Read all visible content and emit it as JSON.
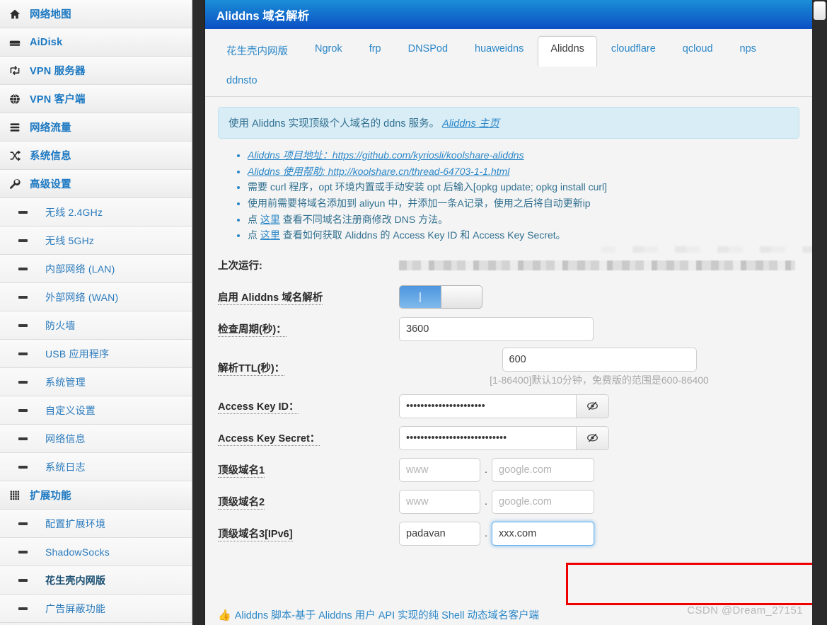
{
  "sidebar": {
    "items": [
      {
        "label": "网络地图",
        "icon": "home-icon",
        "level": "top"
      },
      {
        "label": "AiDisk",
        "icon": "disk-icon",
        "level": "top"
      },
      {
        "label": "VPN 服务器",
        "icon": "exchange-icon",
        "level": "top"
      },
      {
        "label": "VPN 客户端",
        "icon": "globe-icon",
        "level": "top"
      },
      {
        "label": "网络流量",
        "icon": "bars-icon",
        "level": "top"
      },
      {
        "label": "系统信息",
        "icon": "shuffle-icon",
        "level": "top"
      },
      {
        "label": "高级设置",
        "icon": "wrench-icon",
        "level": "top"
      },
      {
        "label": "无线 2.4GHz",
        "icon": "dash-icon",
        "level": "sub"
      },
      {
        "label": "无线 5GHz",
        "icon": "dash-icon",
        "level": "sub"
      },
      {
        "label": "内部网络 (LAN)",
        "icon": "dash-icon",
        "level": "sub"
      },
      {
        "label": "外部网络 (WAN)",
        "icon": "dash-icon",
        "level": "sub"
      },
      {
        "label": "防火墙",
        "icon": "dash-icon",
        "level": "sub"
      },
      {
        "label": "USB 应用程序",
        "icon": "dash-icon",
        "level": "sub"
      },
      {
        "label": "系统管理",
        "icon": "dash-icon",
        "level": "sub"
      },
      {
        "label": "自定义设置",
        "icon": "dash-icon",
        "level": "sub"
      },
      {
        "label": "网络信息",
        "icon": "dash-icon",
        "level": "sub"
      },
      {
        "label": "系统日志",
        "icon": "dash-icon",
        "level": "sub"
      },
      {
        "label": "扩展功能",
        "icon": "grid-icon",
        "level": "top"
      },
      {
        "label": "配置扩展环境",
        "icon": "dash-icon",
        "level": "sub"
      },
      {
        "label": "ShadowSocks",
        "icon": "dash-icon",
        "level": "sub"
      },
      {
        "label": "花生壳内网版",
        "icon": "dash-icon",
        "level": "sub",
        "active": true
      },
      {
        "label": "广告屏蔽功能",
        "icon": "dash-icon",
        "level": "sub"
      }
    ]
  },
  "panel": {
    "title": "Aliddns 域名解析",
    "tabs": [
      {
        "label": "花生壳内网版",
        "active": false
      },
      {
        "label": "Ngrok",
        "active": false
      },
      {
        "label": "frp",
        "active": false
      },
      {
        "label": "DNSPod",
        "active": false
      },
      {
        "label": "huaweidns",
        "active": false
      },
      {
        "label": "Aliddns",
        "active": true
      },
      {
        "label": "cloudflare",
        "active": false
      },
      {
        "label": "qcloud",
        "active": false
      },
      {
        "label": "nps",
        "active": false
      },
      {
        "label": "ddnsto",
        "active": false
      }
    ],
    "notice": {
      "text": "使用 Aliddns 实现顶级个人域名的 ddns 服务。",
      "link": "Aliddns 主页"
    },
    "hints": [
      {
        "prefix": "",
        "link": "Aliddns 项目地址：https://github.com/kyriosli/koolshare-aliddns",
        "suffix": "",
        "italic": true
      },
      {
        "prefix": "",
        "link": "Aliddns 使用帮助: http://koolshare.cn/thread-64703-1-1.html",
        "suffix": "",
        "italic": true
      },
      {
        "prefix": "需要 curl 程序，opt 环境内置或手动安装 opt 后输入[opkg update; opkg install curl]",
        "link": "",
        "suffix": "",
        "italic": false
      },
      {
        "prefix": "使用前需要将域名添加到 aliyun 中，并添加一条A记录，使用之后将自动更新ip",
        "link": "",
        "suffix": "",
        "italic": false
      },
      {
        "prefix": "点 ",
        "link": "这里",
        "suffix": " 查看不同域名注册商修改 DNS 方法。",
        "italic": false
      },
      {
        "prefix": "点 ",
        "link": "这里",
        "suffix": " 查看如何获取 Aliddns 的 Access Key ID 和 Access Key Secret。",
        "italic": false
      }
    ],
    "form": {
      "last_run_label": "上次运行:",
      "last_run_value": "",
      "enable_label": "启用 Aliddns 域名解析",
      "enable_state": "on",
      "interval_label": "检查周期(秒)：",
      "interval_value": "3600",
      "ttl_label": "解析TTL(秒)：",
      "ttl_value": "600",
      "ttl_helper": "[1-86400]默认10分钟，免费版的范围是600-86400",
      "akid_label": "Access Key ID：",
      "akid_value": "••••••••••••••••••••••",
      "aksecret_label": "Access Key Secret：",
      "aksecret_value": "••••••••••••••••••••••••••••",
      "eye_icon": "eye-slash-icon",
      "domains": [
        {
          "label": "顶级域名1",
          "host_value": "",
          "host_placeholder": "www",
          "sep": ".",
          "domain_value": "",
          "domain_placeholder": "google.com",
          "highlight": false,
          "focused": false
        },
        {
          "label": "顶级域名2",
          "host_value": "",
          "host_placeholder": "www",
          "sep": ".",
          "domain_value": "",
          "domain_placeholder": "google.com",
          "highlight": false,
          "focused": false
        },
        {
          "label": "顶级域名3[IPv6]",
          "host_value": "padavan",
          "host_placeholder": "www",
          "sep": ".",
          "domain_value": "xxx.com",
          "domain_placeholder": "google.com",
          "highlight": true,
          "focused": true
        }
      ]
    },
    "footer_link": {
      "icon": "thumbs-up-icon",
      "text": "Aliddns 脚本-基于 Aliddns 用户 API 实现的纯 Shell 动态域名客户端"
    }
  },
  "watermark": "CSDN @Dream_27151",
  "colors": {
    "header_top": "#1b8ed6",
    "header_bottom": "#0b4fc4",
    "link": "#2b87c8",
    "notice_bg": "#d9edf7",
    "highlight_red": "#ee0000",
    "toggle_on": "#4d96df"
  }
}
